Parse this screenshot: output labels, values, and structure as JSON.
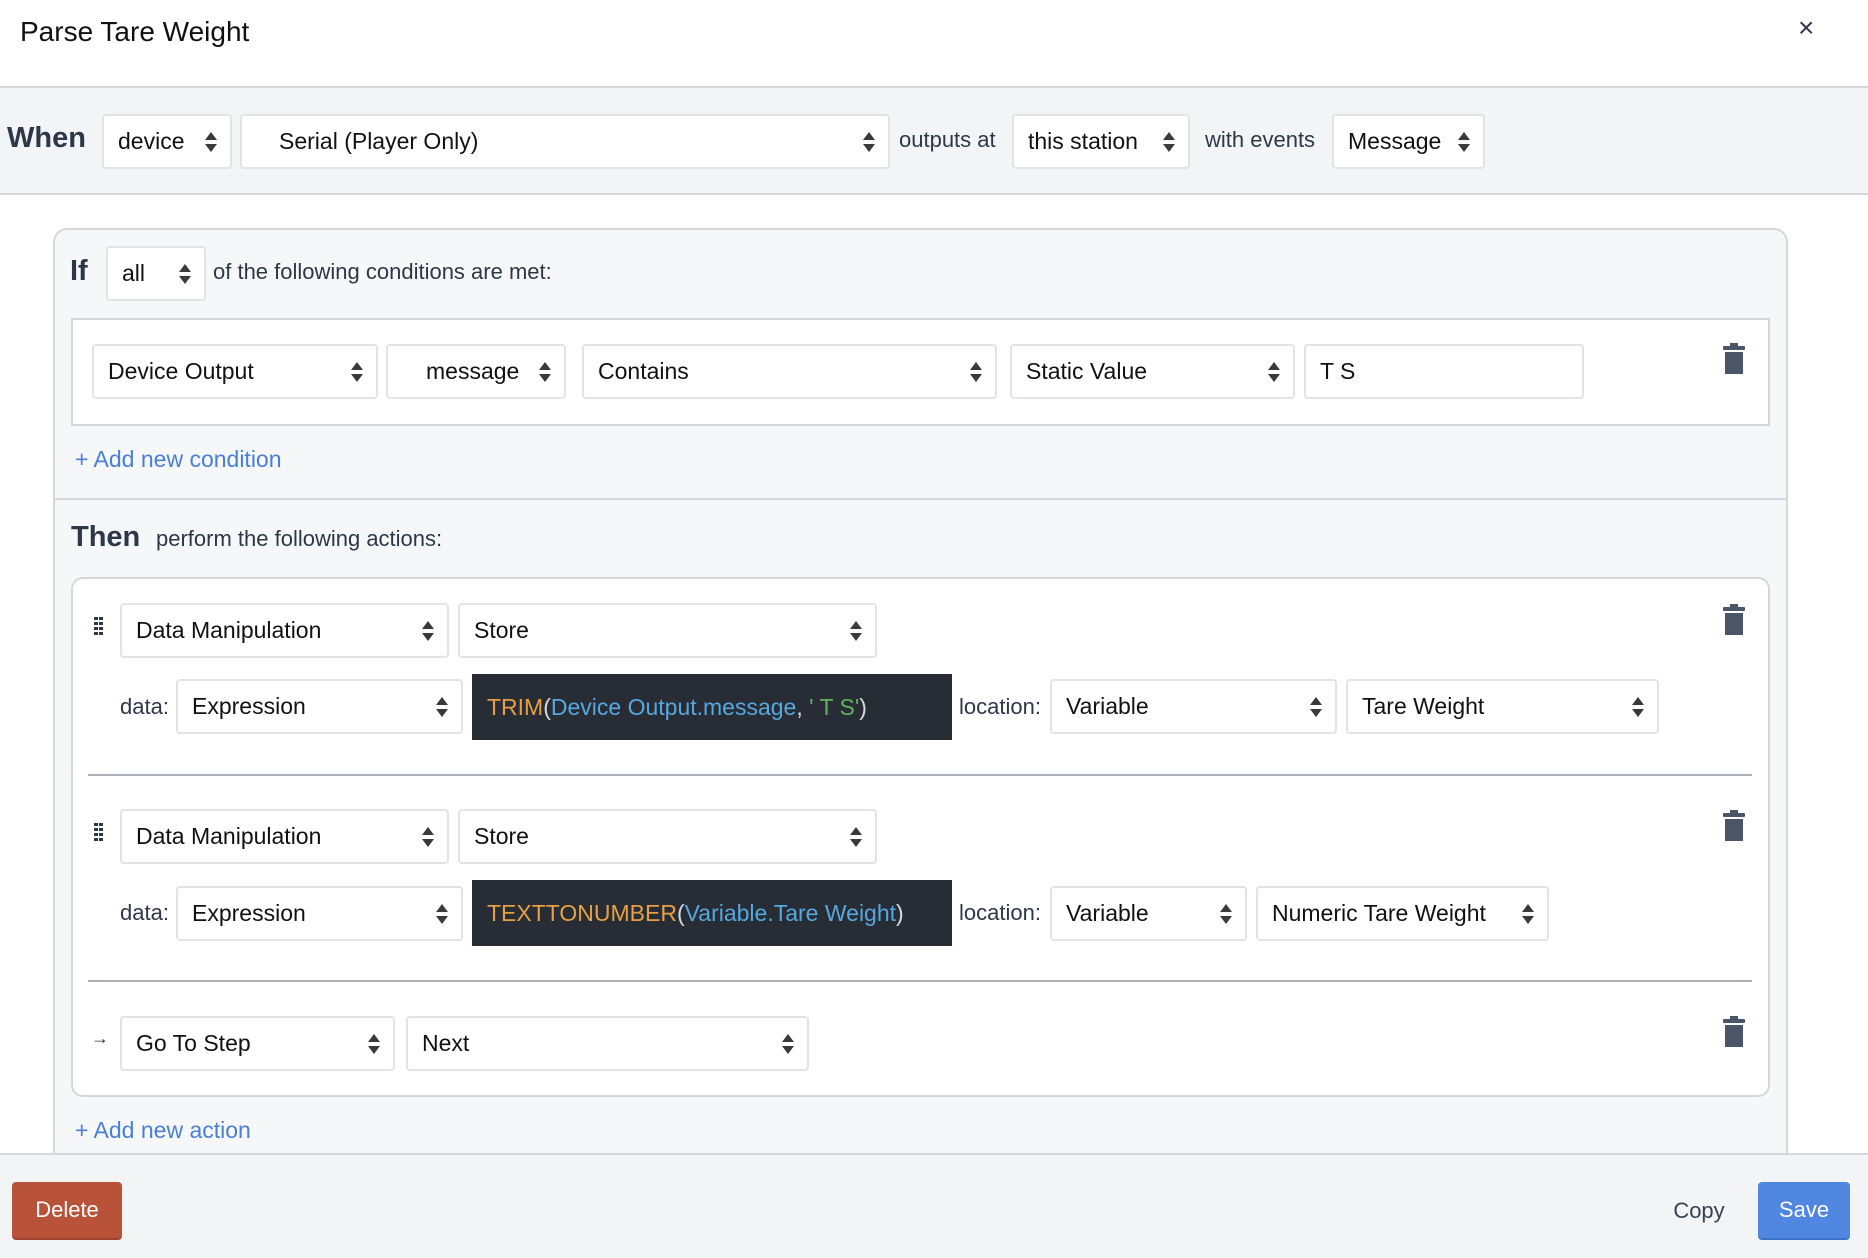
{
  "dialog": {
    "title": "Parse Tare Weight",
    "close_label": "×"
  },
  "when": {
    "keyword": "When",
    "source_type": "device",
    "device": "Serial (Player Only)",
    "outputs_at_label": "outputs at",
    "station": "this station",
    "with_events_label": "with events",
    "event": "Message"
  },
  "if": {
    "keyword": "If",
    "match": "all",
    "suffix": "of the following conditions are met:",
    "conditions": [
      {
        "source": "Device Output",
        "field": "message",
        "operator": "Contains",
        "value_type": "Static Value",
        "value": "T S"
      }
    ],
    "add_condition_label": "+ Add new condition"
  },
  "then": {
    "keyword": "Then",
    "suffix": "perform the following actions:",
    "data_label": "data:",
    "location_label": "location:",
    "actions": [
      {
        "category": "Data Manipulation",
        "type": "Store",
        "data_type": "Expression",
        "expression": {
          "fn": "TRIM",
          "open": "(",
          "arg": "Device Output.message",
          "sep": ", ",
          "str": "' T S'",
          "close": ")"
        },
        "location_type": "Variable",
        "location": "Tare Weight"
      },
      {
        "category": "Data Manipulation",
        "type": "Store",
        "data_type": "Expression",
        "expression": {
          "fn": "TEXTTONUMBER",
          "open": "(",
          "arg": "Variable.Tare Weight",
          "close": ")"
        },
        "location_type": "Variable",
        "location": "Numeric Tare Weight"
      },
      {
        "category": "Go To Step",
        "type": "Next"
      }
    ],
    "add_action_label": "+ Add new action"
  },
  "footer": {
    "delete_label": "Delete",
    "copy_label": "Copy",
    "save_label": "Save"
  },
  "colors": {
    "delete": "#b8533a",
    "save": "#4e86e0",
    "link": "#4a7fd8",
    "code_bg": "#282c34"
  }
}
